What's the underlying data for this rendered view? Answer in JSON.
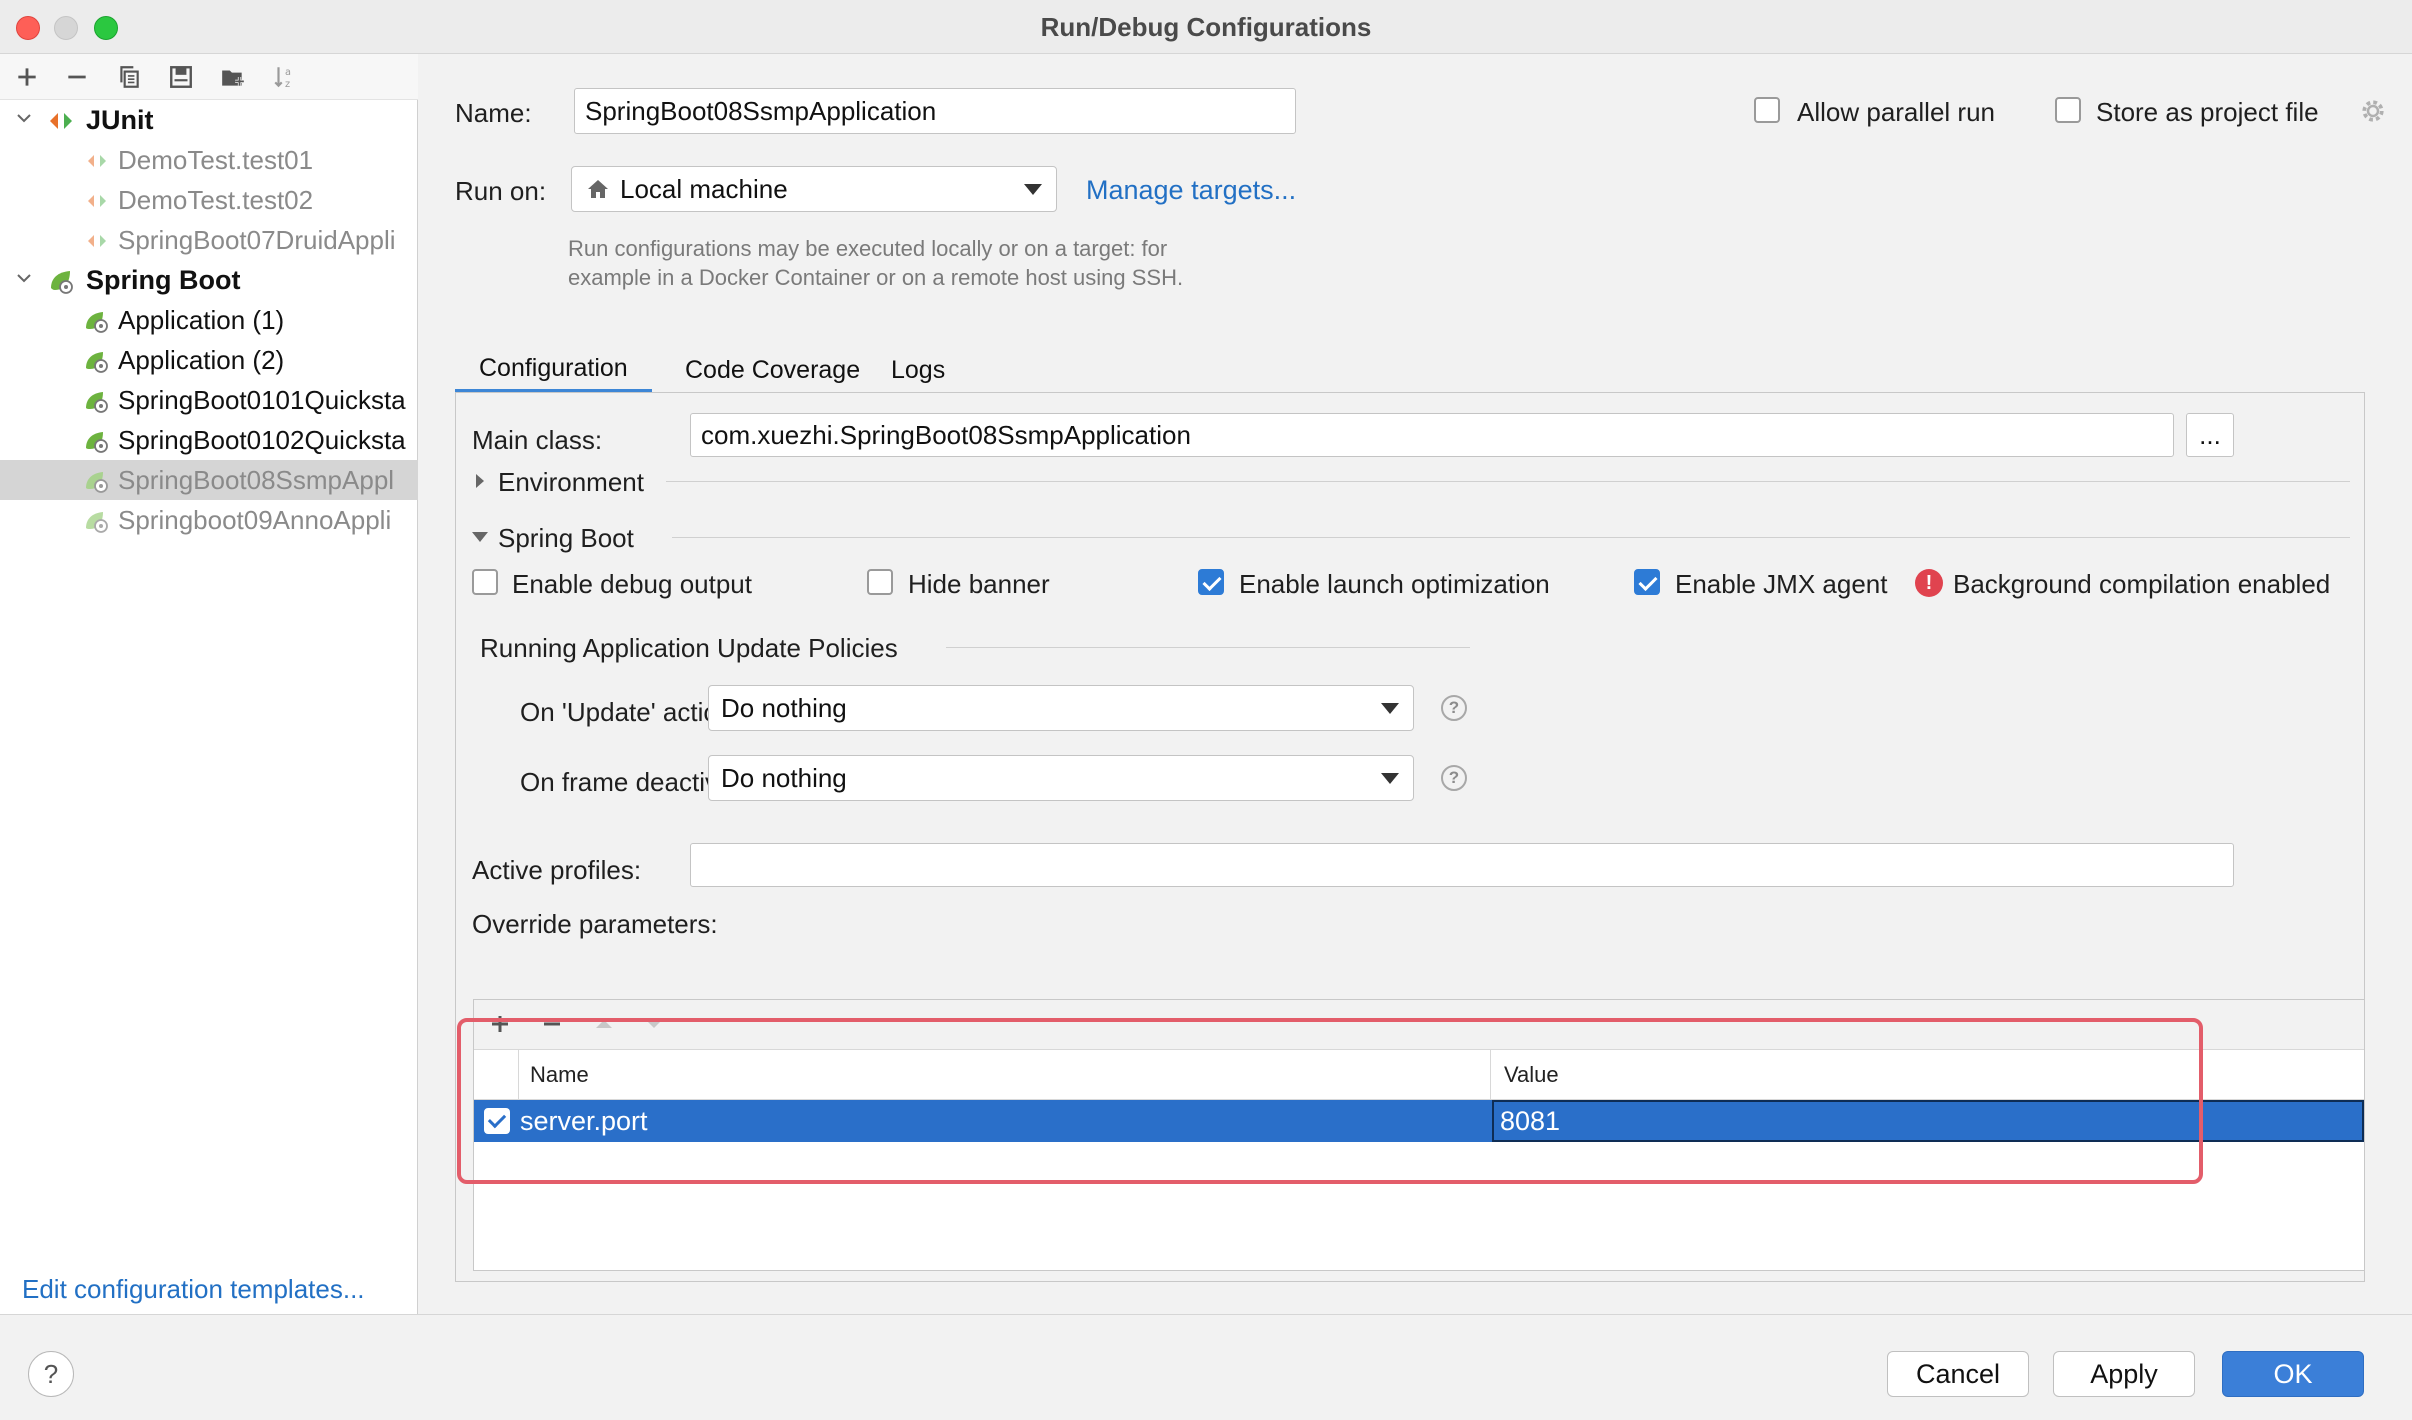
{
  "window": {
    "title": "Run/Debug Configurations"
  },
  "left": {
    "toolbar": [
      "add-icon",
      "remove-icon",
      "copy-icon",
      "save-icon",
      "folder-add-icon",
      "sort-icon"
    ],
    "groups": [
      {
        "label": "JUnit",
        "items": [
          {
            "label": "DemoTest.test01"
          },
          {
            "label": "DemoTest.test02"
          },
          {
            "label": "SpringBoot07DruidAppli"
          }
        ]
      },
      {
        "label": "Spring Boot",
        "items": [
          {
            "label": "Application (1)"
          },
          {
            "label": "Application (2)"
          },
          {
            "label": "SpringBoot0101Quicksta"
          },
          {
            "label": "SpringBoot0102Quicksta"
          },
          {
            "label": "SpringBoot08SsmpAppl"
          },
          {
            "label": "Springboot09AnnoAppli"
          }
        ]
      }
    ],
    "edit_templates": "Edit configuration templates..."
  },
  "form": {
    "name_label": "Name:",
    "name_value": "SpringBoot08SsmpApplication",
    "allow_parallel": "Allow parallel run",
    "store_project": "Store as project file",
    "run_on_label": "Run on:",
    "run_on_value": "Local machine",
    "manage_targets": "Manage targets...",
    "hint_line1": "Run configurations may be executed locally or on a target: for",
    "hint_line2": "example in a Docker Container or on a remote host using SSH."
  },
  "tabs": [
    "Configuration",
    "Code Coverage",
    "Logs"
  ],
  "config": {
    "main_class_label": "Main class:",
    "main_class_value": "com.xuezhi.SpringBoot08SsmpApplication",
    "browse": "...",
    "environment": "Environment",
    "spring_boot": "Spring Boot",
    "enable_debug": "Enable debug output",
    "hide_banner": "Hide banner",
    "enable_launch": "Enable launch optimization",
    "enable_jmx": "Enable JMX agent",
    "bg_compile": "Background compilation enabled",
    "policies_title": "Running Application Update Policies",
    "on_update_label": "On 'Update' action:",
    "on_update_value": "Do nothing",
    "on_frame_label": "On frame deactivation:",
    "on_frame_value": "Do nothing",
    "active_profiles_label": "Active profiles:",
    "active_profiles_value": "",
    "override_label": "Override parameters:",
    "table": {
      "headers": [
        "Name",
        "Value"
      ],
      "rows": [
        {
          "checked": true,
          "name": "server.port",
          "value": "8081"
        }
      ]
    }
  },
  "buttons": {
    "help": "?",
    "cancel": "Cancel",
    "apply": "Apply",
    "ok": "OK"
  },
  "colors": {
    "accent": "#2d7bd6",
    "selection": "#2a6fc9",
    "link": "#2270c4",
    "highlight": "#e35d6a",
    "error": "#e0434f"
  }
}
